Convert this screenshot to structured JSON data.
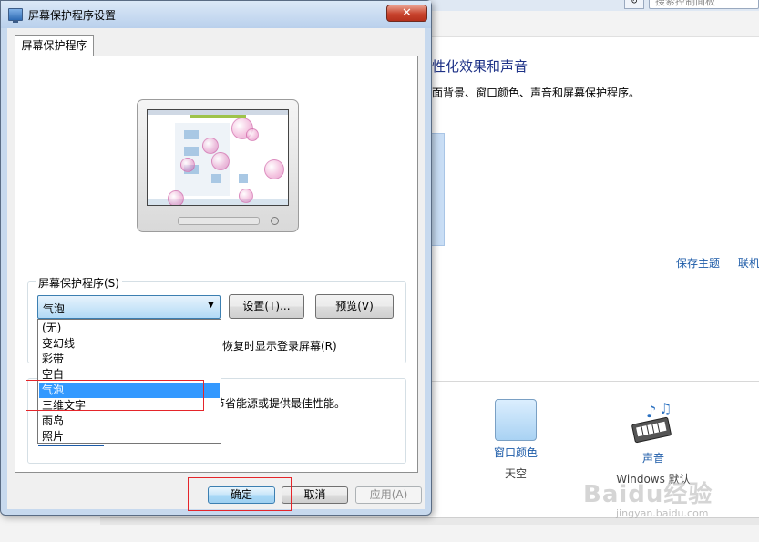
{
  "background_window": {
    "search_placeholder": "搜索控制面板",
    "title": "改个性化效果和声音",
    "title_visible": "性化效果和声音",
    "description_visible": "面背景、窗口颜色、声音和屏幕保护程序。",
    "links": [
      "保存主题",
      "联机"
    ],
    "items": [
      {
        "label": "窗口颜色",
        "sub": "天空",
        "icon": "window-color-icon"
      },
      {
        "label": "声音",
        "sub": "Windows 默认",
        "icon": "sound-icon"
      }
    ],
    "watermark": "Baidu经验",
    "watermark_sub": "jingyan.baidu.com"
  },
  "dialog": {
    "title": "屏幕保护程序设置",
    "close_glyph": "✕",
    "tab_label": "屏幕保护程序",
    "group_label": "屏幕保护程序(S)",
    "selected_saver": "气泡",
    "settings_button": "设置(T)...",
    "preview_button": "预览(V)",
    "resume_text": "恢复时显示登录屏幕(R)",
    "power_text": "节省能源或提供最佳性能。",
    "ok_button": "确定",
    "cancel_button": "取消",
    "apply_button": "应用(A)",
    "dropdown_options": [
      "(无)",
      "变幻线",
      "彩带",
      "空白",
      "气泡",
      "三维文字",
      "雨岛",
      "照片"
    ],
    "selected_index": 4
  },
  "colors": {
    "selection_blue": "#3399ff",
    "annotation_red": "#e5252a",
    "link_blue": "#1c5ba8",
    "title_blue": "#1e3287"
  }
}
